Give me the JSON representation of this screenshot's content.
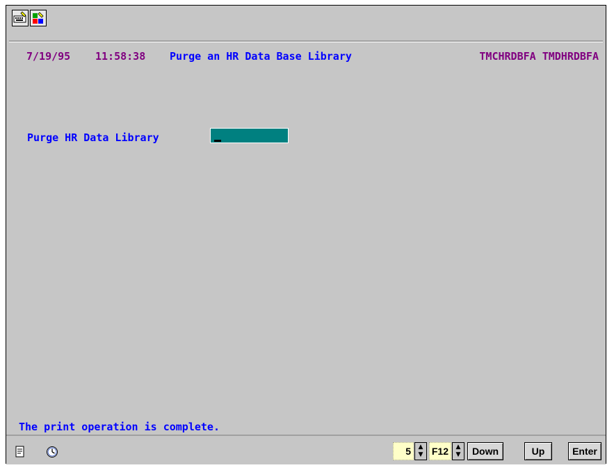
{
  "header": {
    "date": "7/19/95",
    "time": "11:58:38",
    "title": "Purge an HR Data Base Library",
    "programs": "TMCHRDBFA TMDHRDBFA"
  },
  "form": {
    "field_label": "Purge HR Data Library",
    "field_value": ""
  },
  "status": {
    "message": "The print operation is complete."
  },
  "bottom_bar": {
    "count_value": "5",
    "fkey_value": "F12",
    "down_label": "Down",
    "up_label": "Up",
    "enter_label": "Enter"
  },
  "colors": {
    "background": "#c6c6c6",
    "header_purple": "#800080",
    "label_blue": "#0000ff",
    "input_teal": "#008080"
  },
  "icons": {
    "toolbar": [
      "keyboard-edit-icon",
      "color-palette-icon"
    ],
    "bottom": [
      "document-icon",
      "clock-icon"
    ]
  }
}
